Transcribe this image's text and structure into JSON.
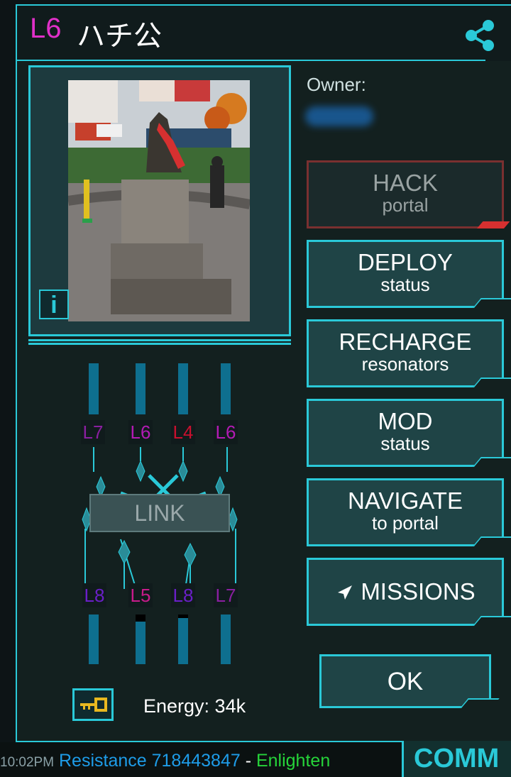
{
  "portal": {
    "level": "L6",
    "name": "ハチ公",
    "owner_label": "Owner:",
    "energy": "Energy: 34k"
  },
  "actions": {
    "hack": {
      "main": "HACK",
      "sub": "portal",
      "enabled": false
    },
    "deploy": {
      "main": "DEPLOY",
      "sub": "status"
    },
    "recharge": {
      "main": "RECHARGE",
      "sub": "resonators"
    },
    "mod": {
      "main": "MOD",
      "sub": "status"
    },
    "navigate": {
      "main": "NAVIGATE",
      "sub": "to portal"
    },
    "missions": {
      "main": "MISSIONS",
      "icon": "missions-arrow-icon"
    },
    "ok": {
      "main": "OK"
    },
    "link": "LINK"
  },
  "resonators": {
    "top": [
      {
        "label": "L7",
        "color": "#8a1fa0",
        "fill": 1.0
      },
      {
        "label": "L6",
        "color": "#b21bb4",
        "fill": 1.0
      },
      {
        "label": "L4",
        "color": "#c8102e",
        "fill": 1.0
      },
      {
        "label": "L6",
        "color": "#b21bb4",
        "fill": 1.0
      }
    ],
    "bottom": [
      {
        "label": "L8",
        "color": "#6a1fc8",
        "fill": 1.0
      },
      {
        "label": "L5",
        "color": "#c81b8a",
        "fill": 0.86
      },
      {
        "label": "L8",
        "color": "#6a1fc8",
        "fill": 0.93
      },
      {
        "label": "L7",
        "color": "#8a1fa0",
        "fill": 1.0
      }
    ]
  },
  "comm": {
    "time": "10:02PM",
    "resistance": "Resistance 718443847",
    "separator": " - ",
    "enlightened": "Enlighten",
    "button": "COMM",
    "colors": {
      "resistance": "#1e9ce8",
      "enlightened": "#26d33a"
    }
  },
  "colors": {
    "accent": "#2ac9d8",
    "level": "#e030c8"
  }
}
